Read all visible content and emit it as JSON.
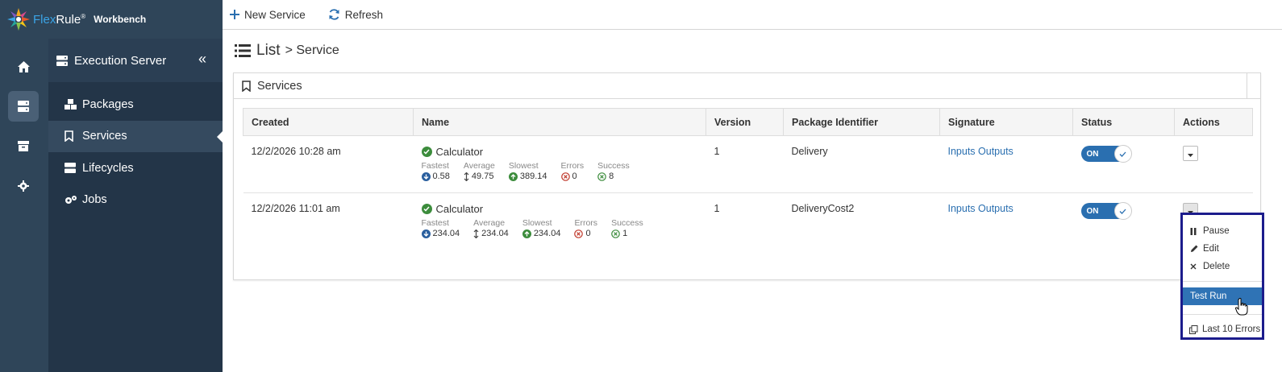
{
  "brand": {
    "name_part1": "Flex",
    "name_part2": "Rule",
    "reg": "®",
    "product": "Workbench"
  },
  "rail": {
    "items": [
      "home-icon",
      "server-icon",
      "archive-icon",
      "gear-icon"
    ],
    "active_index": 1
  },
  "sidebar": {
    "title": "Execution Server",
    "items": [
      {
        "label": "Packages",
        "icon": "cubes-icon"
      },
      {
        "label": "Services",
        "icon": "bookmark-icon",
        "active": true
      },
      {
        "label": "Lifecycles",
        "icon": "server-icon"
      },
      {
        "label": "Jobs",
        "icon": "gears-icon"
      }
    ]
  },
  "toolbar": {
    "new_service": "New Service",
    "refresh": "Refresh"
  },
  "page": {
    "title": "List",
    "subtitle": "> Service"
  },
  "panel": {
    "title": "Services"
  },
  "table": {
    "columns": [
      "Created",
      "Name",
      "Version",
      "Package Identifier",
      "Signature",
      "Status",
      "Actions"
    ],
    "stat_labels": {
      "fastest": "Fastest",
      "average": "Average",
      "slowest": "Slowest",
      "errors": "Errors",
      "success": "Success"
    },
    "rows": [
      {
        "created": "12/2/2026 10:28 am",
        "name": "Calculator",
        "fastest": "0.58",
        "average": "49.75",
        "slowest": "389.14",
        "errors": "0",
        "success": "8",
        "version": "1",
        "package": "Delivery",
        "signature": "Inputs Outputs",
        "status": "ON"
      },
      {
        "created": "12/2/2026 11:01 am",
        "name": "Calculator",
        "fastest": "234.04",
        "average": "234.04",
        "slowest": "234.04",
        "errors": "0",
        "success": "1",
        "version": "1",
        "package": "DeliveryCost2",
        "signature": "Inputs Outputs",
        "status": "ON"
      }
    ]
  },
  "menu": {
    "pause": "Pause",
    "edit": "Edit",
    "delete": "Delete",
    "test_run": "Test Run",
    "last_errors": "Last 10 Errors"
  },
  "colors": {
    "sidebar": "#233548",
    "rail": "#2f4559",
    "accent": "#2a6fb0",
    "success": "#3c8c3c",
    "error": "#c0392b",
    "menu_border": "#1c1c8c"
  }
}
